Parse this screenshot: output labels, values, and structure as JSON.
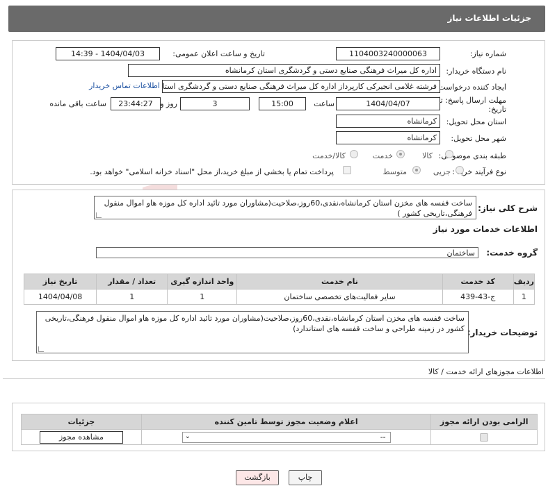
{
  "header": {
    "title": "جزئیات اطلاعات نیاز"
  },
  "info": {
    "need_number_label": "شماره نیاز:",
    "need_number": "1104003240000063",
    "announce_label": "تاریخ و ساعت اعلان عمومی:",
    "announce_value": "1404/04/03 - 14:39",
    "buyer_org_label": "نام دستگاه خریدار:",
    "buyer_org": "اداره کل میراث فرهنگی  صنایع دستی و گردشگری استان کرمانشاه",
    "creator_label": "ایجاد کننده درخواست:",
    "creator": "فرشته غلامی انجیرکی کارپرداز اداره کل میراث فرهنگی  صنایع دستی و گردشگری استان کرمانشاه",
    "contact_link": "اطلاعات تماس خریدار",
    "deadline_label_1": "مهلت ارسال پاسخ: تا",
    "deadline_label_2": "تاریخ:",
    "deadline_date": "1404/04/07",
    "time_label": "ساعت",
    "deadline_time": "15:00",
    "days_value": "3",
    "days_label": "روز و",
    "remaining_time": "23:44:27",
    "remaining_label": "ساعت باقی مانده",
    "province_label": "استان محل تحویل:",
    "province": "کرمانشاه",
    "city_label": "شهر محل تحویل:",
    "city": "کرمانشاه",
    "category_label": "طبقه بندی موضوعی:",
    "category_options": [
      "کالا",
      "خدمت",
      "کالا/خدمت"
    ],
    "category_selected": "خدمت",
    "purchase_label": "نوع فرآیند خرید :",
    "purchase_options": [
      "جزیی",
      "متوسط"
    ],
    "purchase_selected": "متوسط",
    "treasury_note": "پرداخت تمام یا بخشی از مبلغ خرید،از محل \"اسناد خزانه اسلامی\" خواهد بود."
  },
  "need": {
    "description_label": "شرح کلی نیاز:",
    "description": "ساخت قفسه های مخزن استان کرمانشاه،نقدی،60روز،صلاحیت(مشاوران مورد تائید اداره کل موزه هاو اموال منقول فرهنگی،تاریخی کشور )",
    "services_title": "اطلاعات خدمات مورد نیاز",
    "service_group_label": "گروه خدمت:",
    "service_group": "ساختمان",
    "table": {
      "headers": [
        "ردیف",
        "کد خدمت",
        "نام خدمت",
        "واحد اندازه گیری",
        "تعداد / مقدار",
        "تاریخ نیاز"
      ],
      "rows": [
        [
          "1",
          "ج-43-439",
          "سایر فعالیت‌های تخصصی ساختمان",
          "1",
          "1",
          "1404/04/08"
        ]
      ]
    },
    "buyer_notes_label": "توضیحات خریدار:",
    "buyer_notes": "ساخت قفسه های مخزن استان کرمانشاه،نقدی،60روز،صلاحیت(مشاوران مورد تائید اداره کل موزه هاو اموال منقول فرهنگی،تاریخی کشور در زمینه طراحی و ساخت قفسه های استاندارد)"
  },
  "permits": {
    "section_title": "اطلاعات مجوزهای ارائه خدمت / کالا",
    "headers": [
      "الزامی بودن ارائه مجوز",
      "اعلام وضعیت مجوز توسط تامین کننده",
      "جزئیات"
    ],
    "select_value": "--",
    "view_button": "مشاهده مجوز"
  },
  "actions": {
    "print": "چاپ",
    "back": "بازگشت"
  },
  "colors": {
    "header_bg": "#6a6a6a",
    "link": "#1a4fa0",
    "back_button_bg": "#fde7e7"
  }
}
